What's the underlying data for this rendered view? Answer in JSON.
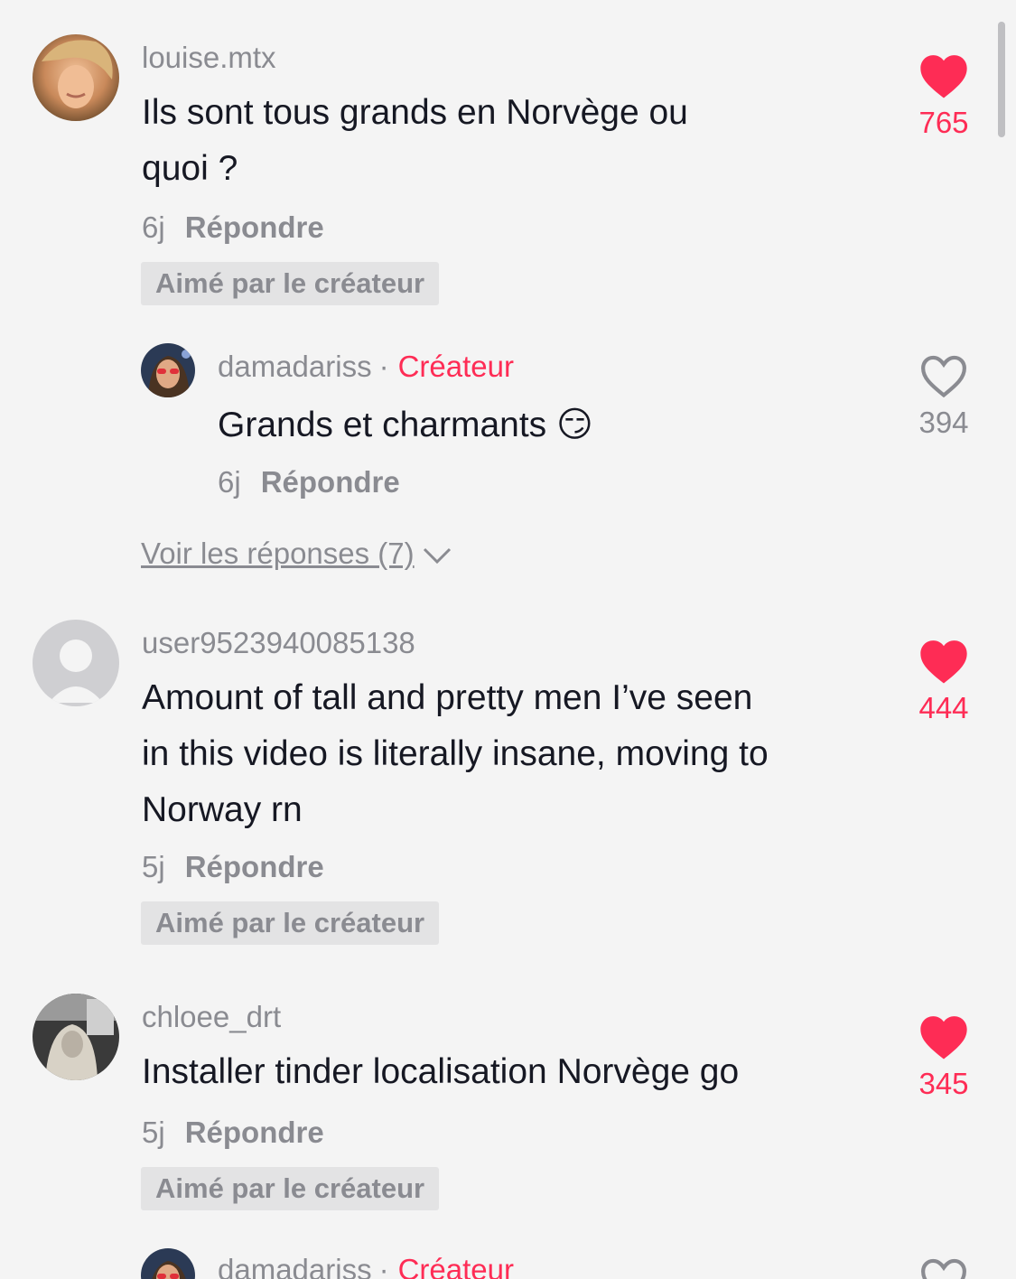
{
  "comments": [
    {
      "username": "louise.mtx",
      "text_line1": "Ils sont tous grands en Norvège ou",
      "text_line2": "quoi ?",
      "age": "6j",
      "reply_label": "Répondre",
      "badge": "Aimé par le créateur",
      "likes": "765",
      "liked": true
    },
    {
      "username": "user9523940085138",
      "text_line1": "Amount of tall and pretty men I’ve seen",
      "text_line2": "in this video is literally insane, moving to",
      "text_line3": "Norway rn",
      "age": "5j",
      "reply_label": "Répondre",
      "badge": "Aimé par le créateur",
      "likes": "444",
      "liked": true
    },
    {
      "username": "chloee_drt",
      "text_line1": "Installer tinder localisation Norvège go",
      "age": "5j",
      "reply_label": "Répondre",
      "badge": "Aimé par le créateur",
      "likes": "345",
      "liked": true
    }
  ],
  "reply": {
    "username": "damadariss",
    "separator": "·",
    "creator_label": "Créateur",
    "text": "Grands et charmants 😏",
    "age": "6j",
    "reply_label": "Répondre",
    "likes": "394",
    "liked": false
  },
  "reply_partial": {
    "username": "damadariss",
    "separator": "·",
    "creator_label": "Créateur"
  },
  "view_replies": "Voir les réponses (7)",
  "icons": {
    "like_filled": "heart-filled-icon",
    "like_outline": "heart-outline-icon",
    "expand": "chevron-down-icon",
    "default_avatar": "user-placeholder-icon"
  },
  "colors": {
    "accent": "#fe2c55",
    "muted": "#8a8b91",
    "text": "#161823",
    "background": "#f4f4f4"
  }
}
